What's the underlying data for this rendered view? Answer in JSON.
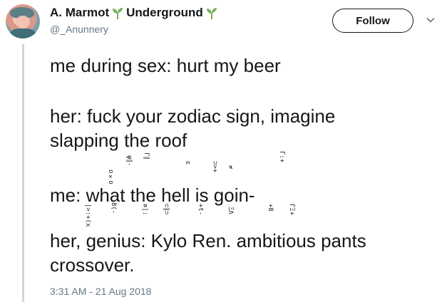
{
  "author": {
    "display_name_1": "A. Marmot",
    "display_name_2": "Underground",
    "handle": "@_Anunnery",
    "accent_color": "#1da1f2",
    "sprout_color": "#77b255"
  },
  "actions": {
    "follow_label": "Follow",
    "menu_icon": "chevron-down-icon"
  },
  "tweet": {
    "line1": "me during sex: hurt my beer",
    "line2": "her: fuck your zodiac sign, imagine",
    "line3": "slapping the roof",
    "line4": "me: what the  hell is goin-",
    "line5": "her, genius: Kylo Ren. ambitious pants",
    "line6": "crossover.",
    "glitch": [
      "|>:+(x",
      "o×o",
      "8(-",
      "≡|:",
      "⊂∥⊃",
      "ψ∥-",
      "Γ∥",
      "ε",
      "+t-",
      "⊃>+",
      "≠",
      "ΞΛ",
      "+8",
      "Γ:+",
      "ΓΞ+"
    ]
  },
  "timestamp": "3:31 AM - 21 Aug 2018"
}
